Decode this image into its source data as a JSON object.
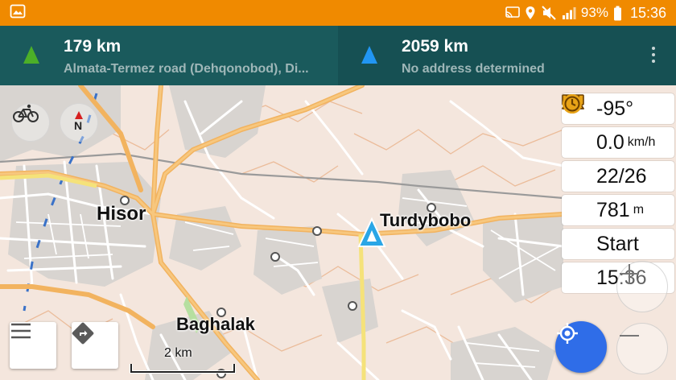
{
  "status_bar": {
    "battery_percent": "93%",
    "time": "15:36",
    "icons": [
      "gallery-icon",
      "cast-icon",
      "location-icon",
      "mute-icon",
      "signal-icon",
      "battery-icon"
    ]
  },
  "navigation": {
    "target_1": {
      "distance": "179 km",
      "address": "Almata-Termez road (Dehqonobod), Di...",
      "arrow_color": "#4caf28"
    },
    "target_2": {
      "distance": "2059 km",
      "address": "No address determined",
      "arrow_color": "#2196f3"
    },
    "menu_icon": "more-vertical-icon"
  },
  "map": {
    "places": {
      "hisor": "Hisor",
      "turdybobo": "Turdybobo",
      "baghalak": "Baghalak"
    },
    "scale": "2 km",
    "compass_letter": "N"
  },
  "info_widgets": [
    {
      "icon": "compass-icon",
      "value": "-95°",
      "unit": ""
    },
    {
      "icon": "speed-icon",
      "value": "0.0",
      "unit": "km/h"
    },
    {
      "icon": "gps-signal-icon",
      "value": "22/26",
      "unit": ""
    },
    {
      "icon": "altitude-icon",
      "value": "781",
      "unit": "m"
    },
    {
      "icon": "ruler-icon",
      "value": "Start",
      "unit": ""
    },
    {
      "icon": "clock-icon",
      "value": "15:36",
      "unit": ""
    }
  ],
  "colors": {
    "status_bar": "#f08a00",
    "header": "#165053",
    "accent_blue": "#2f6de8",
    "widget_icon": "#e8a317"
  }
}
